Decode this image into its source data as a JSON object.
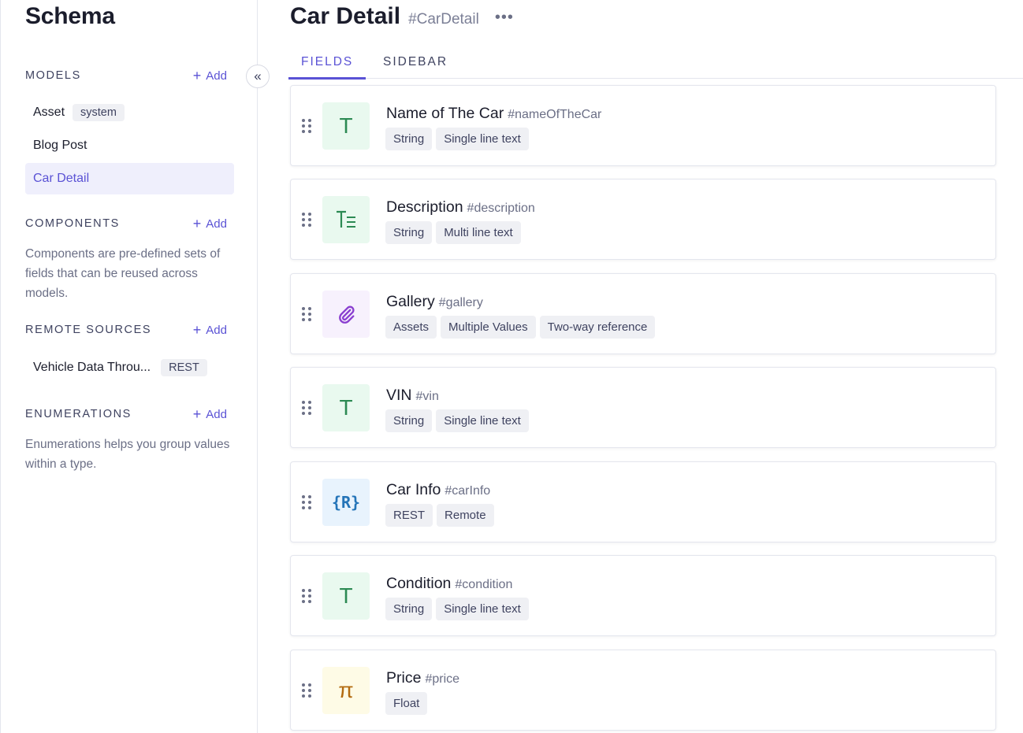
{
  "sidebar": {
    "title": "Schema",
    "models": {
      "label": "MODELS",
      "add": "Add",
      "items": [
        {
          "label": "Asset",
          "badge": "system"
        },
        {
          "label": "Blog Post"
        },
        {
          "label": "Car Detail",
          "active": true
        }
      ]
    },
    "components": {
      "label": "COMPONENTS",
      "add": "Add",
      "description": "Components are pre-defined sets of fields that can be reused across models."
    },
    "remote_sources": {
      "label": "REMOTE SOURCES",
      "add": "Add",
      "items": [
        {
          "label": "Vehicle Data Throu...",
          "badge": "REST"
        }
      ]
    },
    "enumerations": {
      "label": "ENUMERATIONS",
      "add": "Add",
      "description": "Enumerations helps you group values within a type."
    }
  },
  "main": {
    "title": "Car Detail",
    "api_id": "#CarDetail",
    "tabs": [
      {
        "label": "FIELDS",
        "active": true
      },
      {
        "label": "SIDEBAR"
      }
    ],
    "fields": [
      {
        "name": "Name of The Car",
        "api_id": "#nameOfTheCar",
        "icon": "single-line-text-icon",
        "glyph": "T",
        "tags": [
          "String",
          "Single line text"
        ]
      },
      {
        "name": "Description",
        "api_id": "#description",
        "icon": "multi-line-text-icon",
        "glyph": "T=",
        "tags": [
          "String",
          "Multi line text"
        ]
      },
      {
        "name": "Gallery",
        "api_id": "#gallery",
        "icon": "paperclip-icon",
        "glyph": "",
        "tags": [
          "Assets",
          "Multiple Values",
          "Two-way reference"
        ]
      },
      {
        "name": "VIN",
        "api_id": "#vin",
        "icon": "single-line-text-icon",
        "glyph": "T",
        "tags": [
          "String",
          "Single line text"
        ]
      },
      {
        "name": "Car Info",
        "api_id": "#carInfo",
        "icon": "remote-field-icon",
        "glyph": "{R}",
        "tags": [
          "REST",
          "Remote"
        ]
      },
      {
        "name": "Condition",
        "api_id": "#condition",
        "icon": "single-line-text-icon",
        "glyph": "T",
        "tags": [
          "String",
          "Single line text"
        ]
      },
      {
        "name": "Price",
        "api_id": "#price",
        "icon": "float-icon",
        "glyph": "π",
        "tags": [
          "Float"
        ]
      }
    ]
  },
  "colors": {
    "accent": "#5a52d5",
    "text_green": "#2c8a53",
    "text_purple": "#8a3fd0",
    "text_blue": "#2474b8",
    "text_yellow": "#b36b10"
  }
}
